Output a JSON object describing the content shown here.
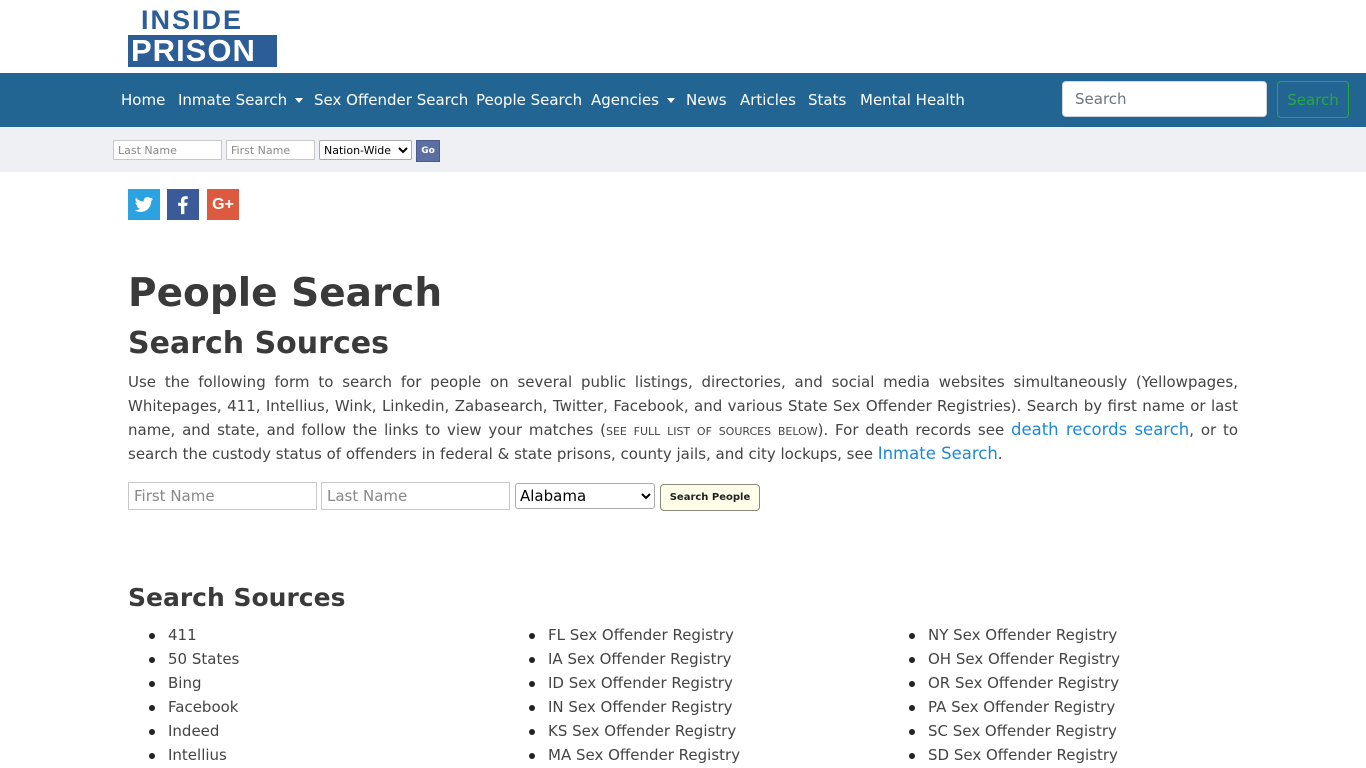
{
  "logo": {
    "line1": "INSIDE",
    "line2": "PRISON"
  },
  "nav": {
    "items": [
      {
        "label": "Home",
        "dropdown": false
      },
      {
        "label": "Inmate Search",
        "dropdown": true
      },
      {
        "label": "Sex Offender Search",
        "dropdown": false
      },
      {
        "label": "People Search",
        "dropdown": false
      },
      {
        "label": "Agencies",
        "dropdown": true
      },
      {
        "label": "News",
        "dropdown": false
      },
      {
        "label": "Articles",
        "dropdown": false
      },
      {
        "label": "Stats",
        "dropdown": false
      },
      {
        "label": "Mental Health",
        "dropdown": false
      }
    ],
    "search_placeholder": "Search",
    "search_button": "Search"
  },
  "quickbar": {
    "last_name_placeholder": "Last Name",
    "first_name_placeholder": "First Name",
    "scope_selected": "Nation-Wide",
    "go_label": "Go"
  },
  "social": {
    "twitter": "twitter-icon",
    "facebook": "facebook-icon",
    "google": "google-plus-icon",
    "google_glyph": "G+"
  },
  "main": {
    "title": "People Search",
    "subtitle": "Search Sources",
    "intro_part1": "Use the following form to search for people on several public listings, directories, and social media websites simultaneously (Yellowpages, Whitepages, 411, Intellius, Wink, Linkedin, Zabasearch, Twitter, Facebook, and various State Sex Offender Registries). Search by first name or last name, and state, and follow the links to view your matches (",
    "intro_smallcaps": "see full list of sources below",
    "intro_part2": "). For death records see ",
    "death_link": "death records search",
    "intro_part3": ", or to search the custody status of offenders in federal & state prisons, county jails, and city lockups, see ",
    "inmate_link": "Inmate Search",
    "intro_part4": "."
  },
  "people_form": {
    "first_name_placeholder": "First Name",
    "last_name_placeholder": "Last Name",
    "state_selected": "Alabama",
    "button": "Search People"
  },
  "sources": {
    "heading": "Search Sources",
    "col1": [
      "411",
      "50 States",
      "Bing",
      "Facebook",
      "Indeed",
      "Intellius"
    ],
    "col2": [
      "FL Sex Offender Registry",
      "IA Sex Offender Registry",
      "ID Sex Offender Registry",
      "IN Sex Offender Registry",
      "KS Sex Offender Registry",
      "MA Sex Offender Registry"
    ],
    "col3": [
      "NY Sex Offender Registry",
      "OH Sex Offender Registry",
      "OR Sex Offender Registry",
      "PA Sex Offender Registry",
      "SC Sex Offender Registry",
      "SD Sex Offender Registry"
    ]
  }
}
